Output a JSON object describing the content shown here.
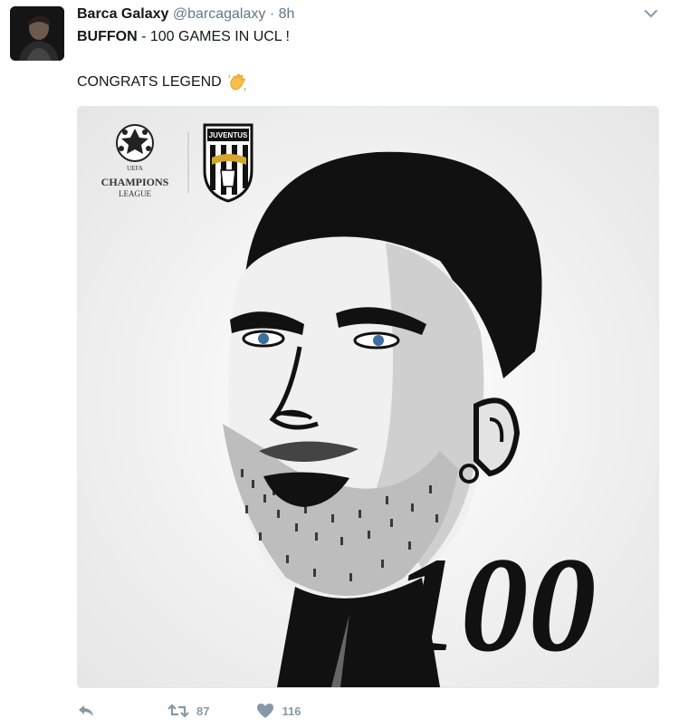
{
  "tweet": {
    "display_name": "Barca Galaxy",
    "handle": "@barcagalaxy",
    "separator": "·",
    "time": "8h",
    "text_bold": "BUFFON",
    "text_rest": " - 100 GAMES IN UCL !",
    "text_line2": "CONGRATS LEGEND",
    "emoji_icon": "waving-hand-icon"
  },
  "media": {
    "cl_logo_line1": "UEFA",
    "cl_logo_line2": "CHAMPIONS",
    "cl_logo_line3": "LEAGUE",
    "juve_badge_text": "JUVENTUS",
    "number_text": "100"
  },
  "actions": {
    "reply_icon": "reply-icon",
    "retweet_icon": "retweet-icon",
    "retweet_count": "87",
    "like_icon": "heart-icon",
    "like_count": "116"
  },
  "colors": {
    "text": "#14171a",
    "muted": "#657786",
    "action": "#8899a6",
    "border": "#e1e8ed",
    "like_fill": "#8899a6"
  }
}
